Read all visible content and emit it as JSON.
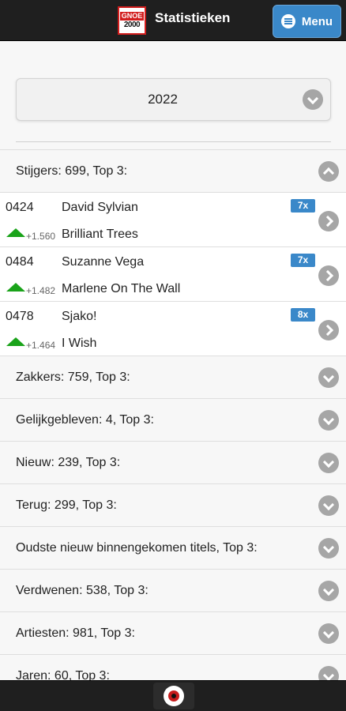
{
  "header": {
    "logo_text_top": "GNOE",
    "logo_text_bottom": "2000",
    "title": "Statistieken",
    "menu_label": "Menu"
  },
  "year_select": {
    "value": "2022"
  },
  "sections": {
    "stijgers": "Stijgers: 699, Top 3:",
    "zakkers": "Zakkers: 759, Top 3:",
    "gelijk": "Gelijkgebleven: 4, Top 3:",
    "nieuw": "Nieuw: 239, Top 3:",
    "terug": "Terug: 299, Top 3:",
    "oudste": "Oudste nieuw binnengekomen titels, Top 3:",
    "verdwenen": "Verdwenen: 538, Top 3:",
    "artiesten": "Artiesten: 981, Top 3:",
    "jaren": "Jaren: 60, Top 3:"
  },
  "stijgers_entries": [
    {
      "position": "0424",
      "artist": "David Sylvian",
      "title": "Brilliant Trees",
      "change": "+1.560",
      "count_badge": "7x"
    },
    {
      "position": "0484",
      "artist": "Suzanne Vega",
      "title": "Marlene On The Wall",
      "change": "+1.482",
      "count_badge": "7x"
    },
    {
      "position": "0478",
      "artist": "Sjako!",
      "title": "I Wish",
      "change": "+1.464",
      "count_badge": "8x"
    }
  ],
  "icons": {
    "menu": "hamburger-icon",
    "expand": "chevron-down-icon",
    "collapse": "chevron-up-icon",
    "detail": "chevron-right-icon",
    "rise": "triangle-up-icon",
    "home": "record-logo-icon"
  },
  "colors": {
    "topbar": "#1f1f1f",
    "accent": "#3a88c9",
    "rise_green": "#1aa31a",
    "chevron_gray": "#a6a6a6"
  }
}
